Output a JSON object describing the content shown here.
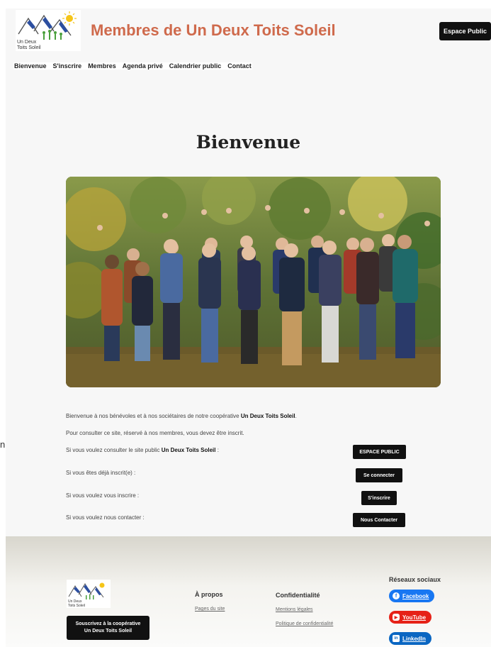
{
  "header": {
    "logo_text": [
      "Un Deux",
      "Toits Soleil"
    ],
    "site_title": "Membres de Un Deux Toits Soleil",
    "espace_public_button": "Espace Public"
  },
  "nav": {
    "items": [
      "Bienvenue",
      "S'inscrire",
      "Membres",
      "Agenda privé",
      "Calendrier public",
      "Contact"
    ]
  },
  "main": {
    "title": "Bienvenue",
    "intro_line1_prefix": "Bienvenue à nos bénévoles et à nos sociétaires de notre coopérative ",
    "intro_line1_strong": "Un Deux Toits Soleil",
    "intro_line1_suffix": ".",
    "intro_line2": "Pour consulter ce site, réservé à nos membres, vous devez être inscrit.",
    "rows": [
      {
        "prefix": "Si vous voulez consulter le site public ",
        "strong": "Un Deux Toits Soleil",
        "suffix": " :",
        "button": "ESPACE PUBLIC"
      },
      {
        "prefix": "Si vous êtes déjà inscrit(e) :",
        "strong": "",
        "suffix": "",
        "button": "Se connecter"
      },
      {
        "prefix": "Si vous voulez vous inscrire :",
        "strong": "",
        "suffix": "",
        "button": "S'inscrire"
      },
      {
        "prefix": "Si vous voulez nous contacter :",
        "strong": "",
        "suffix": "",
        "button": "Nous Contacter"
      }
    ],
    "stray_char": "n"
  },
  "footer": {
    "logo_text": [
      "Un Deux",
      "Toits Soleil"
    ],
    "subscribe_line1": "Souscrivez à la coopérative",
    "subscribe_line2": "Un Deux Toits Soleil",
    "about_heading": "À propos",
    "about_link": "Pages du site",
    "privacy_heading": "Confidentialité",
    "privacy_links": [
      "Mentions légales",
      "Politique de confidentialité"
    ],
    "social_heading": "Réseaux sociaux",
    "social": [
      {
        "label": "Facebook",
        "color": "#1877f2",
        "icon": "f"
      },
      {
        "label": "YouTube",
        "color": "#e62117",
        "icon": "▶"
      },
      {
        "label": "LinkedIn",
        "color": "#0a66c2",
        "icon": "in"
      }
    ]
  },
  "colors": {
    "title_accent": "#cf6a4c",
    "button_dark": "#111111",
    "page_bg": "#f7f7f7"
  }
}
